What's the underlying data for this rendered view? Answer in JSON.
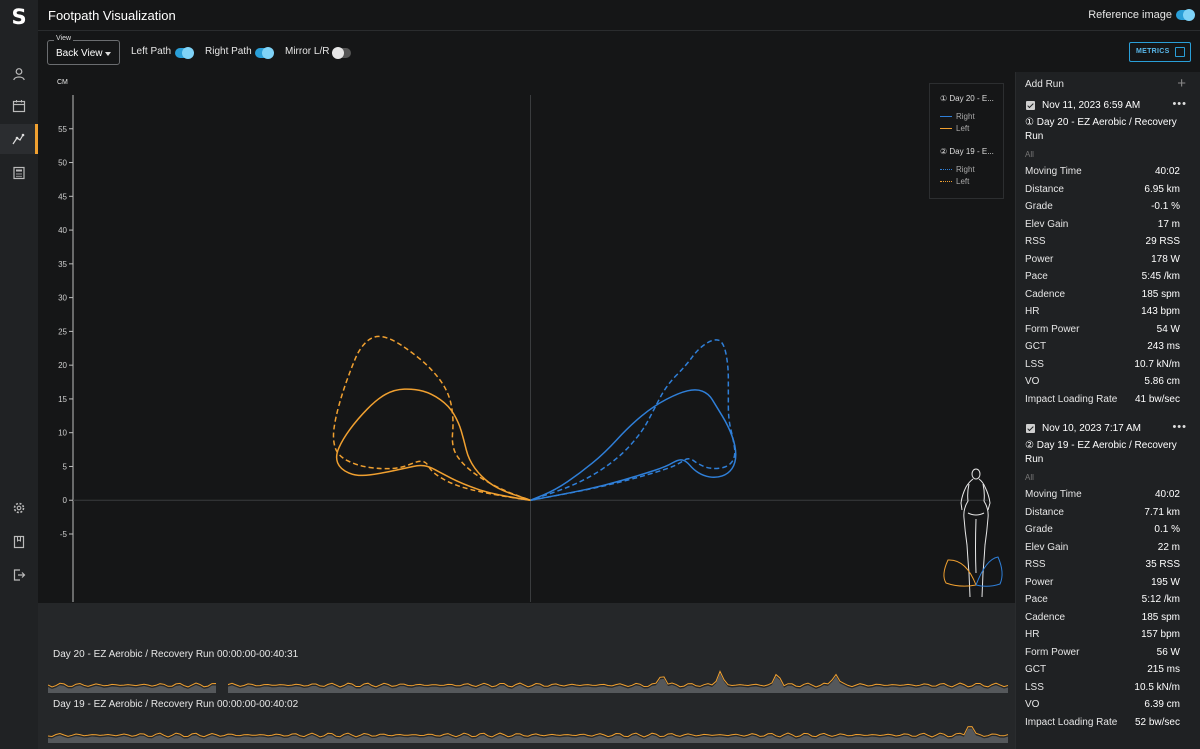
{
  "app": {
    "logo": "S",
    "title": "Footpath Visualization",
    "reference_label": "Reference image",
    "reference_on": true
  },
  "sidebar": {
    "items": [
      {
        "icon": "user-icon"
      },
      {
        "icon": "calendar-icon"
      },
      {
        "icon": "footpath-icon",
        "active": true
      },
      {
        "icon": "calculator-icon"
      },
      {
        "icon": "gear-icon"
      },
      {
        "icon": "book-icon"
      },
      {
        "icon": "logout-icon"
      }
    ]
  },
  "controls": {
    "view_caption": "View",
    "view_value": "Back View",
    "left_path": "Left Path",
    "left_path_on": true,
    "right_path": "Right Path",
    "right_path_on": true,
    "mirror": "Mirror L/R",
    "mirror_on": false,
    "metrics": "METRICS"
  },
  "legend": {
    "run1_title": "① Day 20 - E...",
    "run2_title": "② Day 19 - E...",
    "right": "Right",
    "left": "Left"
  },
  "colors": {
    "right": "#2f7fd8",
    "left": "#f0a030",
    "accent": "#2a9fd8"
  },
  "chart_data": {
    "type": "line",
    "xlabel": "CM",
    "ylabel": "CM",
    "xlim": [
      -18.5,
      18.5
    ],
    "ylim": [
      -5,
      60
    ],
    "xticks": [
      -15,
      -10,
      -5,
      0,
      5,
      10,
      15
    ],
    "yticks": [
      -5,
      0,
      5,
      10,
      15,
      20,
      25,
      30,
      35,
      40,
      45,
      50,
      55
    ],
    "series": [
      {
        "name": "Right",
        "run": "① Day 20 - E...",
        "style": "solid",
        "points": [
          [
            0,
            0
          ],
          [
            1.5,
            1
          ],
          [
            3,
            2.2
          ],
          [
            4.5,
            3.8
          ],
          [
            5.5,
            5
          ],
          [
            6,
            6.1
          ],
          [
            6.3,
            5.8
          ],
          [
            6.6,
            4.5
          ],
          [
            7,
            3.6
          ],
          [
            7.5,
            3.3
          ],
          [
            8,
            3.9
          ],
          [
            8.3,
            5.5
          ],
          [
            8.3,
            8
          ],
          [
            8,
            11
          ],
          [
            7.5,
            14
          ],
          [
            7.2,
            15.8
          ],
          [
            6.7,
            16.5
          ],
          [
            6,
            15.9
          ],
          [
            5,
            14
          ],
          [
            4,
            11
          ],
          [
            3,
            7
          ],
          [
            2,
            4
          ],
          [
            1,
            1.5
          ],
          [
            0,
            0
          ]
        ]
      },
      {
        "name": "Left",
        "run": "① Day 20 - E...",
        "style": "solid",
        "points": [
          [
            0,
            0
          ],
          [
            -1.5,
            0.8
          ],
          [
            -2.8,
            2.5
          ],
          [
            -3.6,
            4
          ],
          [
            -4.1,
            5
          ],
          [
            -4.5,
            5.2
          ],
          [
            -5,
            4.8
          ],
          [
            -6,
            4
          ],
          [
            -7,
            3.5
          ],
          [
            -7.7,
            4.6
          ],
          [
            -7.9,
            6.5
          ],
          [
            -7.6,
            9
          ],
          [
            -7,
            12
          ],
          [
            -6.2,
            15
          ],
          [
            -5.5,
            16.4
          ],
          [
            -4.7,
            16.5
          ],
          [
            -4,
            15.8
          ],
          [
            -3.3,
            14
          ],
          [
            -2.9,
            11.5
          ],
          [
            -2.7,
            9
          ],
          [
            -2.5,
            6
          ],
          [
            -2,
            3.5
          ],
          [
            -1.3,
            1.6
          ],
          [
            0,
            0
          ]
        ]
      },
      {
        "name": "Right",
        "run": "② Day 19 - E...",
        "style": "dashed",
        "points": [
          [
            0,
            0
          ],
          [
            2,
            1.3
          ],
          [
            4,
            3
          ],
          [
            5.5,
            4.6
          ],
          [
            6,
            5.4
          ],
          [
            6.4,
            6.4
          ],
          [
            6.8,
            5.3
          ],
          [
            7.3,
            4.6
          ],
          [
            8,
            4.9
          ],
          [
            8.3,
            6.5
          ],
          [
            8.2,
            9
          ],
          [
            8,
            12
          ],
          [
            8,
            16
          ],
          [
            8,
            20
          ],
          [
            7.8,
            23.5
          ],
          [
            7.4,
            23.9
          ],
          [
            6.8,
            22.5
          ],
          [
            6.3,
            20
          ],
          [
            5.5,
            17
          ],
          [
            5,
            13.5
          ],
          [
            4.5,
            10
          ],
          [
            3.5,
            6
          ],
          [
            2,
            2.5
          ],
          [
            0,
            0
          ]
        ]
      },
      {
        "name": "Left",
        "run": "② Day 19 - E...",
        "style": "dashed",
        "points": [
          [
            0,
            0
          ],
          [
            -1,
            0.5
          ],
          [
            -2.5,
            1.6
          ],
          [
            -3.3,
            2.6
          ],
          [
            -4,
            4.2
          ],
          [
            -4.2,
            5.6
          ],
          [
            -4.5,
            5.9
          ],
          [
            -5.2,
            4.8
          ],
          [
            -6,
            4.6
          ],
          [
            -7,
            5.1
          ],
          [
            -7.8,
            6.6
          ],
          [
            -8,
            9
          ],
          [
            -7.9,
            12
          ],
          [
            -7.6,
            16
          ],
          [
            -7.2,
            20
          ],
          [
            -6.9,
            22.5
          ],
          [
            -6.4,
            24.3
          ],
          [
            -5.8,
            24.2
          ],
          [
            -5,
            22.5
          ],
          [
            -4,
            19.5
          ],
          [
            -3.3,
            16
          ],
          [
            -3.1,
            12
          ],
          [
            -3.2,
            8
          ],
          [
            -2.8,
            5.5
          ],
          [
            -2,
            3.2
          ],
          [
            -1,
            1.3
          ],
          [
            0,
            0
          ]
        ]
      }
    ]
  },
  "timeline": [
    {
      "title": "Day 20 - EZ Aerobic / Recovery Run  00:00:00-00:40:31",
      "spikes": [
        0.64,
        0.7,
        0.76,
        0.82
      ]
    },
    {
      "title": "Day 19 - EZ Aerobic / Recovery Run  00:00:00-00:40:02",
      "spikes": [
        0.96
      ]
    }
  ],
  "panel": {
    "add_run": "Add Run",
    "runs": [
      {
        "date": "Nov 11, 2023 6:59 AM",
        "name": "① Day 20 - EZ Aerobic / Recovery Run",
        "all": "All",
        "metrics": [
          [
            "Moving Time",
            "40:02"
          ],
          [
            "Distance",
            "6.95 km"
          ],
          [
            "Grade",
            "-0.1 %"
          ],
          [
            "Elev Gain",
            "17 m"
          ],
          [
            "RSS",
            "29 RSS"
          ],
          [
            "Power",
            "178 W"
          ],
          [
            "Pace",
            "5:45 /km"
          ],
          [
            "Cadence",
            "185 spm"
          ],
          [
            "HR",
            "143 bpm"
          ],
          [
            "Form Power",
            "54 W"
          ],
          [
            "GCT",
            "243 ms"
          ],
          [
            "LSS",
            "10.7 kN/m"
          ],
          [
            "VO",
            "5.86 cm"
          ],
          [
            "Impact Loading Rate",
            "41 bw/sec"
          ]
        ]
      },
      {
        "date": "Nov 10, 2023 7:17 AM",
        "name": "② Day 19 - EZ Aerobic / Recovery Run",
        "all": "All",
        "metrics": [
          [
            "Moving Time",
            "40:02"
          ],
          [
            "Distance",
            "7.71 km"
          ],
          [
            "Grade",
            "0.1 %"
          ],
          [
            "Elev Gain",
            "22 m"
          ],
          [
            "RSS",
            "35 RSS"
          ],
          [
            "Power",
            "195 W"
          ],
          [
            "Pace",
            "5:12 /km"
          ],
          [
            "Cadence",
            "185 spm"
          ],
          [
            "HR",
            "157 bpm"
          ],
          [
            "Form Power",
            "56 W"
          ],
          [
            "GCT",
            "215 ms"
          ],
          [
            "LSS",
            "10.5 kN/m"
          ],
          [
            "VO",
            "6.39 cm"
          ],
          [
            "Impact Loading Rate",
            "52 bw/sec"
          ]
        ]
      }
    ]
  }
}
